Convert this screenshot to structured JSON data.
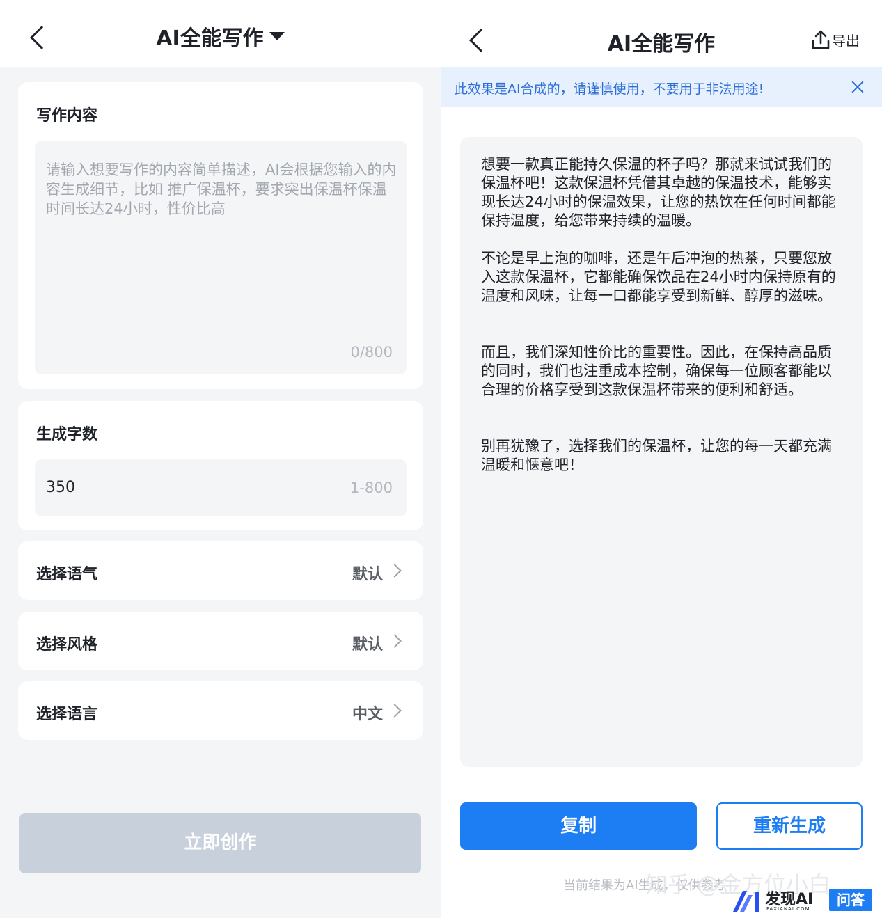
{
  "left": {
    "title": "AI全能写作",
    "content_card": {
      "label": "写作内容",
      "placeholder": "请输入想要写作的内容简单描述，AI会根据您输入的内容生成细节，比如 推广保温杯，要求突出保温杯保温时间长达24小时，性价比高",
      "counter": "0/800"
    },
    "wordcount_card": {
      "label": "生成字数",
      "value": "350",
      "range": "1-800"
    },
    "options": [
      {
        "label": "选择语气",
        "value": "默认"
      },
      {
        "label": "选择风格",
        "value": "默认"
      },
      {
        "label": "选择语言",
        "value": "中文"
      }
    ],
    "create_button": "立即创作"
  },
  "right": {
    "title": "AI全能写作",
    "export_label": "导出",
    "banner": "此效果是AI合成的，请谨慎使用，不要用于非法用途!",
    "paragraphs": [
      "想要一款真正能持久保温的杯子吗？那就来试试我们的保温杯吧！这款保温杯凭借其卓越的保温技术，能够实现长达24小时的保温效果，让您的热饮在任何时间都能保持温度，给您带来持续的温暖。",
      "不论是早上泡的咖啡，还是午后冲泡的热茶，只要您放入这款保温杯，它都能确保饮品在24小时内保持原有的温度和风味，让每一口都能享受到新鲜、醇厚的滋味。",
      "而且，我们深知性价比的重要性。因此，在保持高品质的同时，我们也注重成本控制，确保每一位顾客都能以合理的价格享受到这款保温杯带来的便利和舒适。",
      "别再犹豫了，选择我们的保温杯，让您的每一天都充满温暖和惬意吧！"
    ],
    "copy_button": "复制",
    "regenerate_button": "重新生成",
    "footnote": "当前结果为AI生成，仅供参考",
    "watermark": "知乎 @金方位小白",
    "badge": {
      "brand": "发现AI",
      "sub": "FAXIANAI.COM",
      "qa": "问答"
    }
  },
  "colors": {
    "accent": "#1d7df2",
    "banner_bg": "#e7f0fd",
    "banner_text": "#2d6fd8",
    "disabled_button": "#c8d0db",
    "page_bg": "#f4f5f7"
  },
  "icons": [
    "back-arrow-icon",
    "dropdown-caret-icon",
    "chevron-right-icon",
    "export-icon",
    "close-icon"
  ]
}
